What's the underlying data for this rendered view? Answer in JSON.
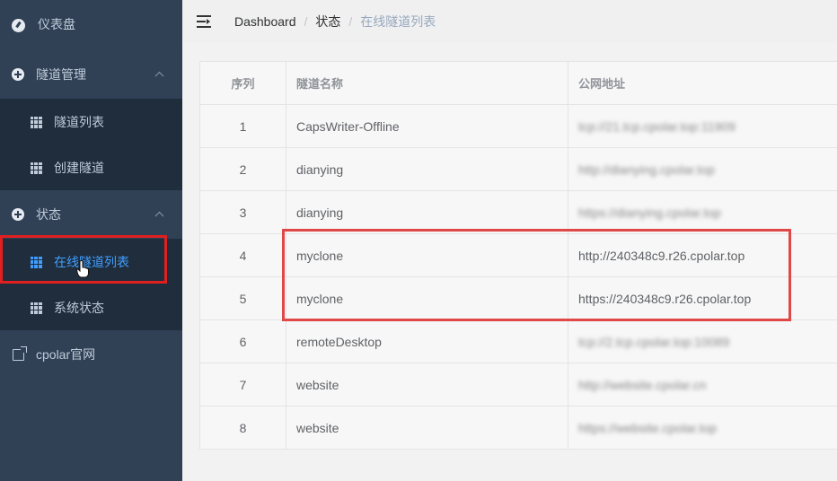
{
  "sidebar": {
    "items": [
      {
        "label": "仪表盘",
        "icon": "dashboard-icon"
      },
      {
        "label": "隧道管理",
        "icon": "plus-circle-icon"
      },
      {
        "label": "隧道列表",
        "icon": "grid-icon"
      },
      {
        "label": "创建隧道",
        "icon": "grid-icon"
      },
      {
        "label": "状态",
        "icon": "plus-circle-icon"
      },
      {
        "label": "在线隧道列表",
        "icon": "grid-icon"
      },
      {
        "label": "系统状态",
        "icon": "grid-icon"
      },
      {
        "label": "cpolar官网",
        "icon": "external-link-icon"
      }
    ]
  },
  "header": {
    "breadcrumb": [
      "Dashboard",
      "状态",
      "在线隧道列表"
    ],
    "separator": "/"
  },
  "table": {
    "columns": [
      "序列",
      "隧道名称",
      "公网地址"
    ],
    "rows": [
      {
        "index": "1",
        "name": "CapsWriter-Offline",
        "address": "tcp://21.tcp.cpolar.top:11909"
      },
      {
        "index": "2",
        "name": "dianying",
        "address": "http://dianying.cpolar.top"
      },
      {
        "index": "3",
        "name": "dianying",
        "address": "https://dianying.cpolar.top"
      },
      {
        "index": "4",
        "name": "myclone",
        "address": "http://240348c9.r26.cpolar.top"
      },
      {
        "index": "5",
        "name": "myclone",
        "address": "https://240348c9.r26.cpolar.top"
      },
      {
        "index": "6",
        "name": "remoteDesktop",
        "address": "tcp://2.tcp.cpolar.top:10089"
      },
      {
        "index": "7",
        "name": "website",
        "address": "http://website.cpolar.cn"
      },
      {
        "index": "8",
        "name": "website",
        "address": "https://website.cpolar.top"
      }
    ]
  },
  "colors": {
    "sidebar_bg": "#304156",
    "submenu_bg": "#1f2d3d",
    "active": "#409eff",
    "highlight": "#e04848"
  }
}
